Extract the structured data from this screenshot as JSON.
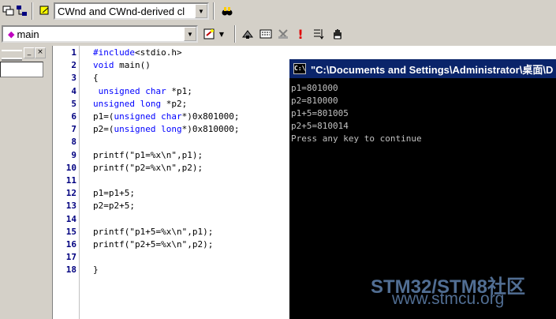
{
  "toolbar1": {
    "class_combo": "CWnd and CWnd-derived cl"
  },
  "toolbar2": {
    "member_combo": "main"
  },
  "editor": {
    "lines": [
      {
        "no": "1",
        "text": "#include<stdio.h>"
      },
      {
        "no": "2",
        "text": "void main()"
      },
      {
        "no": "3",
        "text": "{"
      },
      {
        "no": "4",
        "text": " unsigned char *p1;"
      },
      {
        "no": "5",
        "text": "unsigned long *p2;"
      },
      {
        "no": "6",
        "text": "p1=(unsigned char*)0x801000;"
      },
      {
        "no": "7",
        "text": "p2=(unsigned long*)0x810000;"
      },
      {
        "no": "8",
        "text": ""
      },
      {
        "no": "9",
        "text": "printf(\"p1=%x\\n\",p1);"
      },
      {
        "no": "10",
        "text": "printf(\"p2=%x\\n\",p2);"
      },
      {
        "no": "11",
        "text": ""
      },
      {
        "no": "12",
        "text": "p1=p1+5;"
      },
      {
        "no": "13",
        "text": "p2=p2+5;"
      },
      {
        "no": "14",
        "text": ""
      },
      {
        "no": "15",
        "text": "printf(\"p1+5=%x\\n\",p1);"
      },
      {
        "no": "16",
        "text": "printf(\"p2+5=%x\\n\",p2);"
      },
      {
        "no": "17",
        "text": ""
      },
      {
        "no": "18",
        "text": "}"
      }
    ]
  },
  "console": {
    "title": "\"C:\\Documents and Settings\\Administrator\\桌面\\D",
    "icon_label": "C:\\",
    "output": [
      "p1=801000",
      "p2=810000",
      "p1+5=801005",
      "p2+5=810014",
      "Press any key to continue"
    ]
  },
  "watermark": {
    "line1": "STM32/STM8社区",
    "line2": "www.stmcu.org"
  },
  "colors": {
    "keyword": "#0000ff",
    "line_number": "#000080",
    "title_bar": "#0a246a"
  }
}
